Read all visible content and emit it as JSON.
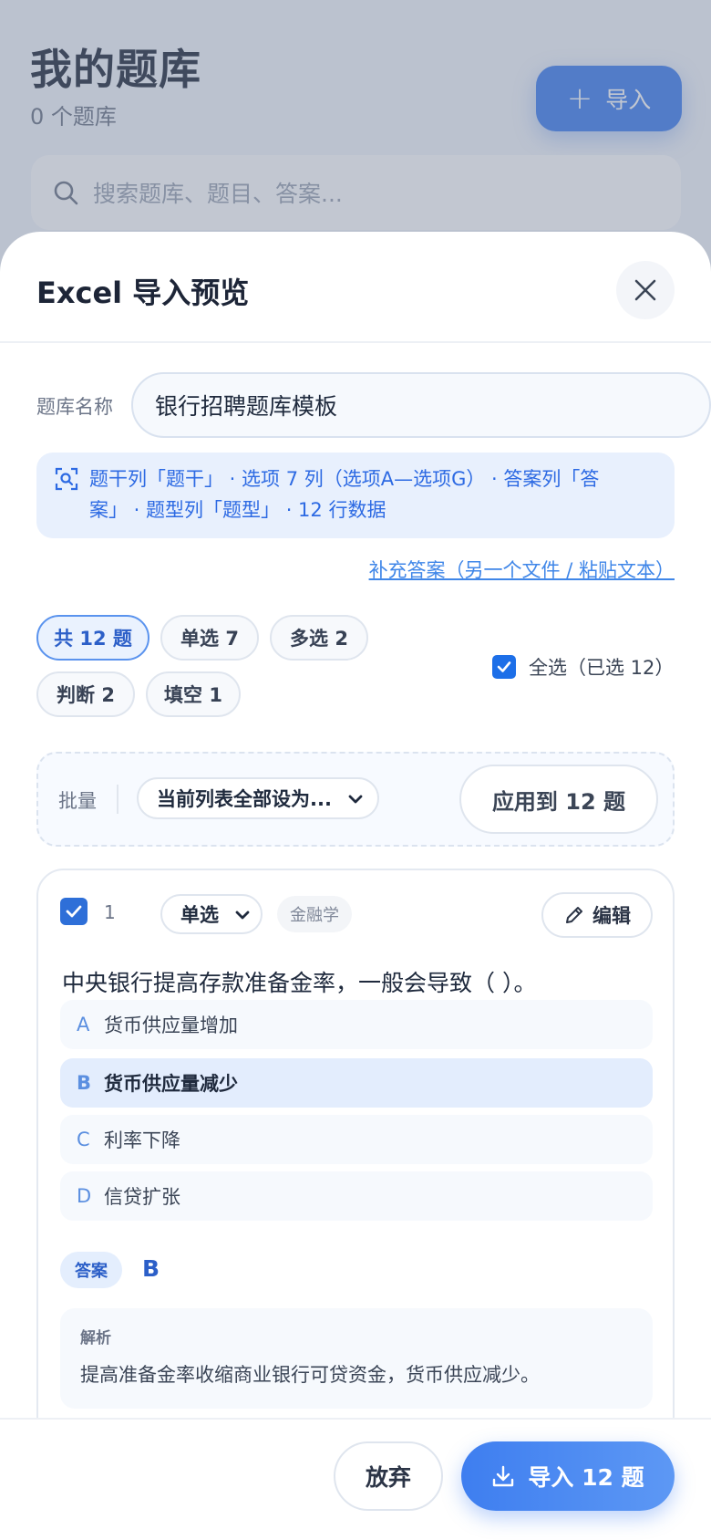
{
  "background": {
    "title": "我的题库",
    "count": "0 个题库",
    "import_label": "导入",
    "search_placeholder": "搜索题库、题目、答案..."
  },
  "sheet": {
    "title": "Excel 导入预览",
    "name_label": "题库名称",
    "name_value": "银行招聘题库模板",
    "info_line1": "题干列「题干」 · 选项 7 列（选项A—选项G） · 答案列「答",
    "info_line2": "案」 · 题型列「题型」 · 12 行数据",
    "supplement_link": "补充答案（另一个文件 / 粘贴文本）",
    "filters": [
      {
        "label": "共 12 题",
        "active": true
      },
      {
        "label": "单选 7",
        "active": false
      },
      {
        "label": "多选 2",
        "active": false
      },
      {
        "label": "判断 2",
        "active": false
      },
      {
        "label": "填空 1",
        "active": false
      }
    ],
    "select_all_label": "全选（已选 12）",
    "batch": {
      "label": "批量",
      "select_value": "当前列表全部设为...",
      "apply_label": "应用到 12 题"
    },
    "question": {
      "number": "1",
      "type": "单选",
      "subject": "金融学",
      "edit_label": "编辑",
      "text": "中央银行提高存款准备金率，一般会导致（ ）。",
      "options": [
        {
          "letter": "A",
          "text": "货币供应量增加",
          "correct": false
        },
        {
          "letter": "B",
          "text": "货币供应量减少",
          "correct": true
        },
        {
          "letter": "C",
          "text": "利率下降",
          "correct": false
        },
        {
          "letter": "D",
          "text": "信贷扩张",
          "correct": false
        }
      ],
      "answer_tag": "答案",
      "answer_value": "B",
      "explanation_label": "解析",
      "explanation_text": "提高准备金率收缩商业银行可贷资金，货币供应减少。"
    },
    "footer": {
      "discard_label": "放弃",
      "import_label": "导入 12 题"
    }
  },
  "colors": {
    "accent": "#3e7ef0",
    "info_bg": "#e8f0fd",
    "correct_bg": "#e3edfd"
  }
}
